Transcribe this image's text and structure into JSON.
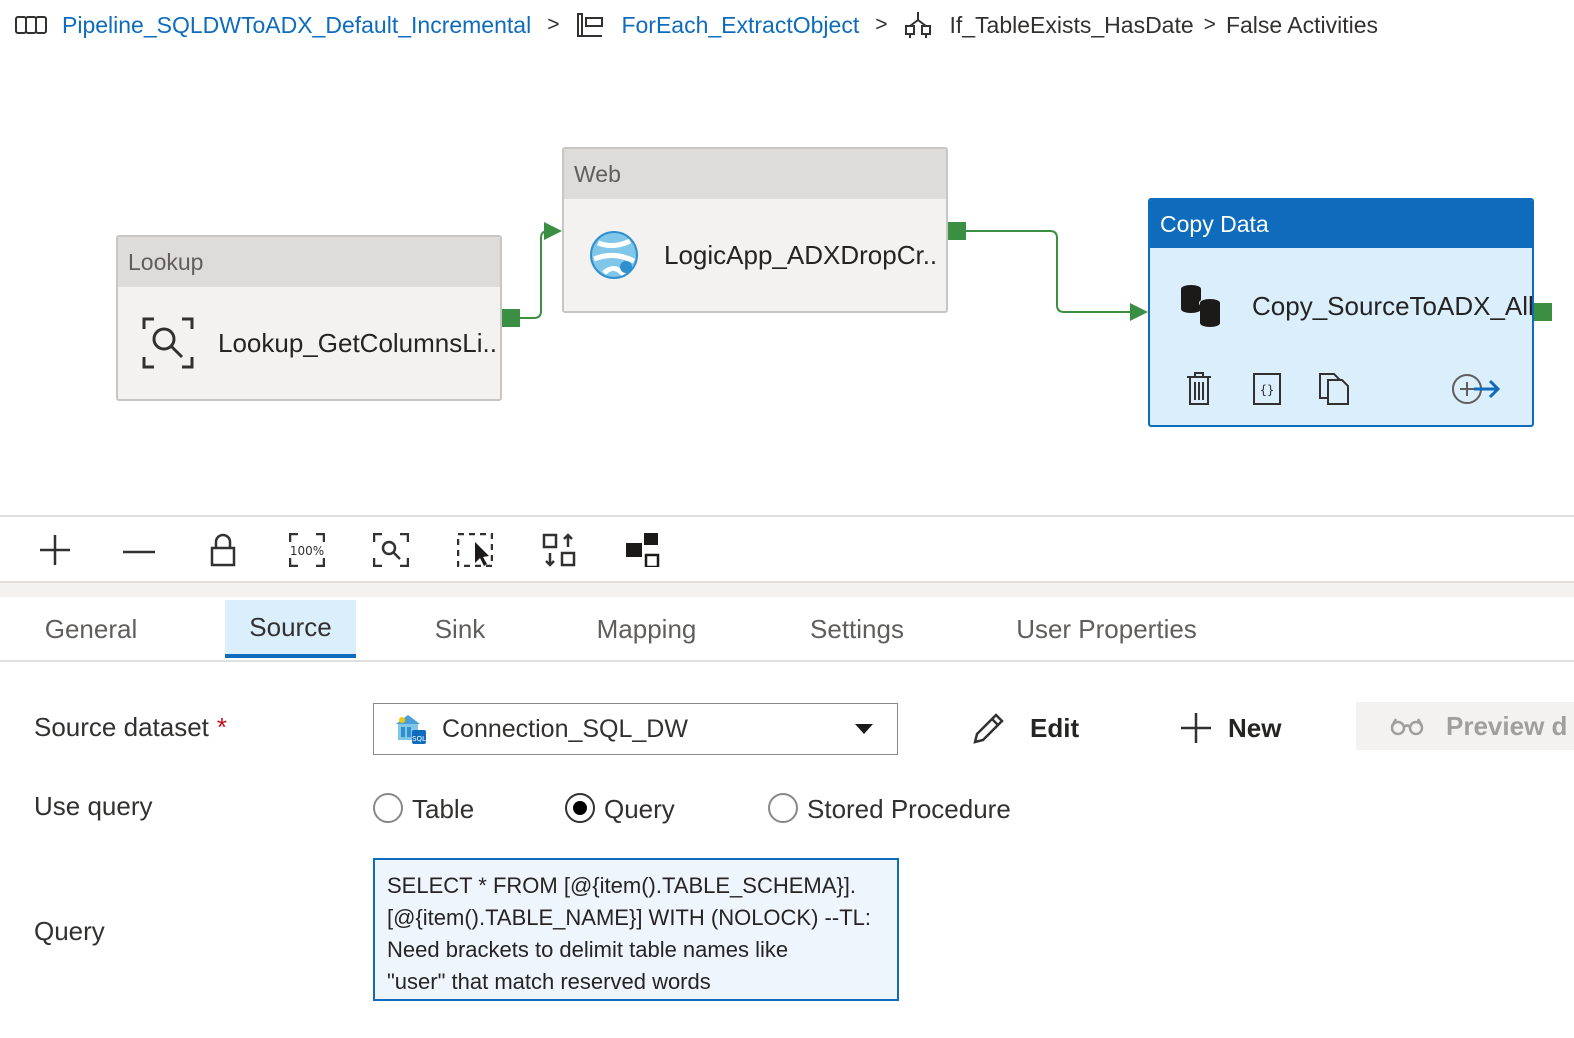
{
  "breadcrumb": {
    "pipeline": "Pipeline_SQLDWToADX_Default_Incremental",
    "foreach": "ForEach_ExtractObject",
    "ifcond": "If_TableExists_HasDate",
    "current": "False Activities",
    "separator": ">"
  },
  "canvas": {
    "nodes": [
      {
        "type": "Lookup",
        "name": "Lookup_GetColumnsLi..",
        "icon": "lookup-icon"
      },
      {
        "type": "Web",
        "name": "LogicApp_ADXDropCr..",
        "icon": "web-globe-icon"
      },
      {
        "type": "Copy Data",
        "name": "Copy_SourceToADX_All",
        "icon": "copy-data-icon",
        "selected": true
      }
    ],
    "actions": [
      "delete-icon",
      "code-icon",
      "clone-icon",
      "add-output-icon"
    ]
  },
  "toolbar": [
    "zoom-in-icon",
    "zoom-out-icon",
    "lock-icon",
    "zoom-100-icon",
    "zoom-to-fit-icon",
    "select-area-icon",
    "auto-align-icon",
    "minimap-icon"
  ],
  "tabs": [
    "General",
    "Source",
    "Sink",
    "Mapping",
    "Settings",
    "User Properties"
  ],
  "active_tab": "Source",
  "source": {
    "dataset_label": "Source dataset",
    "required_mark": "*",
    "dataset_value": "Connection_SQL_DW",
    "edit_label": "Edit",
    "new_label": "New",
    "preview_label": "Preview d",
    "use_query_label": "Use query",
    "options": [
      "Table",
      "Query",
      "Stored Procedure"
    ],
    "selected_option": "Query",
    "query_label": "Query",
    "query_lines": [
      "SELECT * FROM [@{item().TABLE_SCHEMA}].",
      "[@{item().TABLE_NAME}] WITH (NOLOCK) --TL:",
      "Need brackets to delimit table names like",
      "\"user\" that match reserved words"
    ]
  },
  "colors": {
    "accent": "#0f6cbd",
    "selected_fill": "#dbeefb",
    "connector": "#3b8f42",
    "required": "#c50f1f"
  }
}
